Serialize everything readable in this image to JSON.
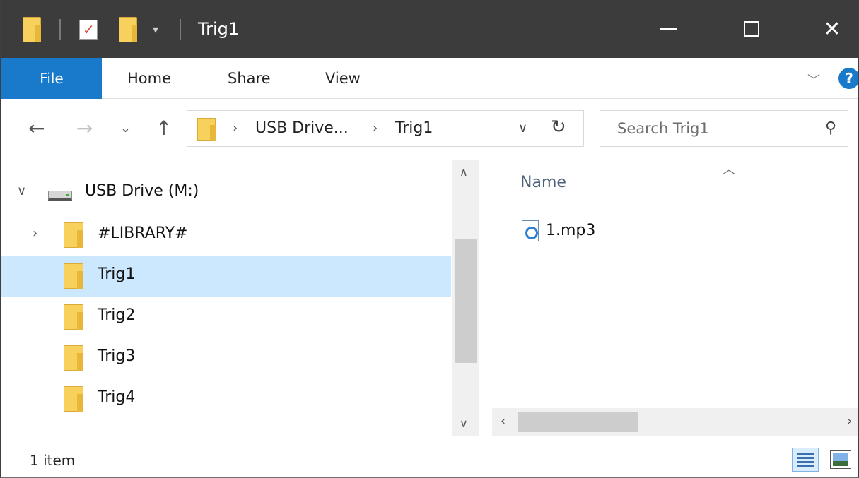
{
  "window": {
    "title": "Trig1",
    "qa_dropdown_glyph": "▾"
  },
  "ribbon": {
    "tabs": [
      {
        "label": "File"
      },
      {
        "label": "Home"
      },
      {
        "label": "Share"
      },
      {
        "label": "View"
      }
    ]
  },
  "address": {
    "crumbs": [
      "USB Drive...",
      "Trig1"
    ]
  },
  "search": {
    "placeholder": "Search Trig1"
  },
  "nav_pane": {
    "items": [
      {
        "label": "USB Drive (M:)",
        "expanded": true
      },
      {
        "label": "#LIBRARY#",
        "expanded": false
      },
      {
        "label": "Trig1",
        "selected": true
      },
      {
        "label": "Trig2"
      },
      {
        "label": "Trig3"
      },
      {
        "label": "Trig4"
      }
    ]
  },
  "content": {
    "column_name": "Name",
    "files": [
      {
        "name": "1.mp3",
        "icon": "mp3-file-icon"
      }
    ]
  },
  "status": {
    "item_count": "1 item"
  },
  "colors": {
    "accent": "#1979ca",
    "title_bar": "#3c3c3c",
    "selection": "#cce8ff",
    "folder": "#f7d15b"
  }
}
